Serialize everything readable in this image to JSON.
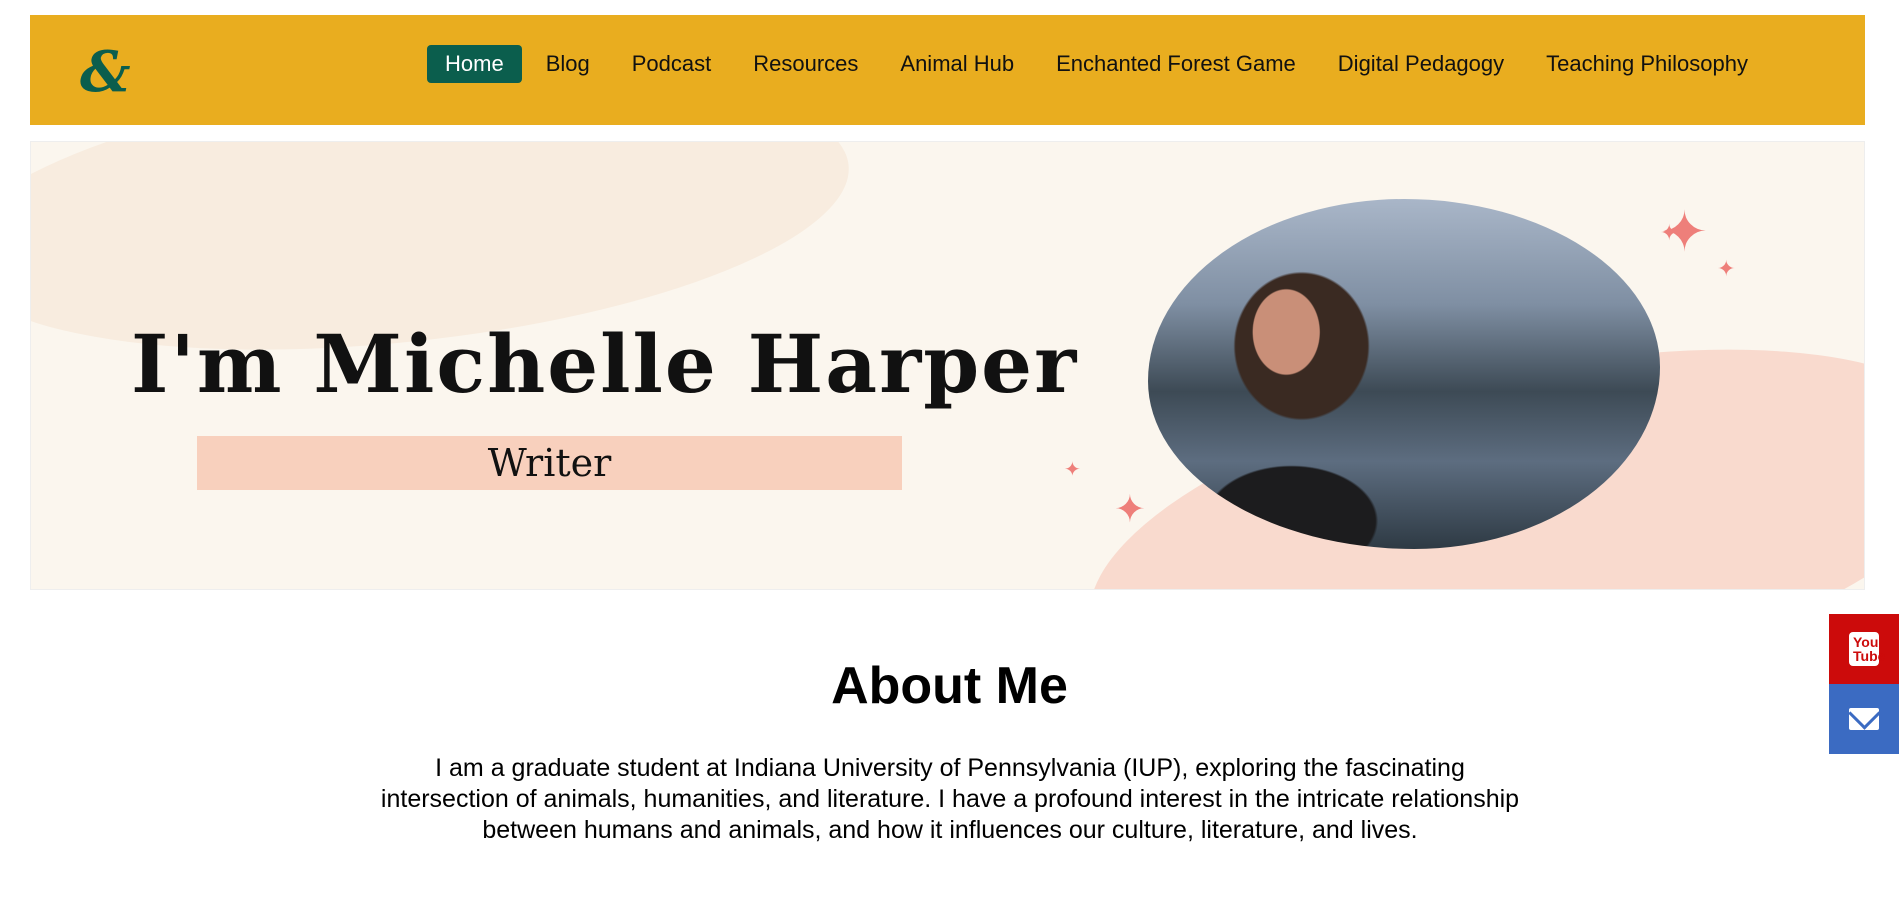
{
  "nav": {
    "logo": "&",
    "items": [
      {
        "label": "Home",
        "active": true
      },
      {
        "label": "Blog"
      },
      {
        "label": "Podcast"
      },
      {
        "label": "Resources"
      },
      {
        "label": "Animal Hub"
      },
      {
        "label": "Enchanted Forest Game"
      },
      {
        "label": "Digital Pedagogy"
      },
      {
        "label": "Teaching Philosophy"
      }
    ]
  },
  "hero": {
    "name": "I'm Michelle Harper",
    "role": "Writer"
  },
  "social": {
    "youtube_icon": "youtube-icon",
    "youtube_text": "You Tube",
    "email_icon": "envelope-icon"
  },
  "about": {
    "title": "About Me",
    "text": "I am a graduate student at Indiana University of Pennsylvania (IUP), exploring the fascinating intersection of animals, humanities, and literature. I have a profound interest in the intricate relationship between humans and animals, and how it influences our culture, literature, and lives."
  },
  "colors": {
    "nav_bg": "#e9ad1f",
    "accent": "#0b5e4d",
    "youtube": "#cc0b0b",
    "email": "#3b6bc2"
  }
}
